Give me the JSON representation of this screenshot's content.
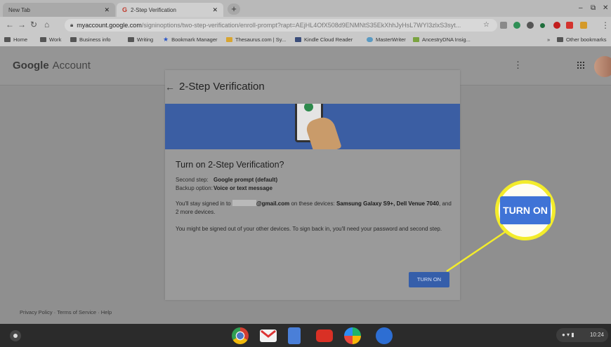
{
  "browser": {
    "tabs": [
      {
        "title": "New Tab",
        "close": "✕"
      },
      {
        "title": "2-Step Verification",
        "close": "✕",
        "favicon": "G"
      }
    ],
    "new_tab": "+",
    "window_controls": {
      "minimize": "–",
      "restore": "⧉",
      "close": "✕"
    },
    "url_host": "myaccount.google.com",
    "url_path": "/signinoptions/two-step-verification/enroll-prompt?rapt=AEjHL4OfX508d9ENMNtS35EkXhhJyHsL7WYI3zlxS3syt...",
    "bookmarks": [
      {
        "label": "Home",
        "icon": "folder-icon"
      },
      {
        "label": "Work",
        "icon": "folder-icon"
      },
      {
        "label": "Business info",
        "icon": "folder-icon"
      },
      {
        "label": "Writing",
        "icon": "folder-icon"
      },
      {
        "label": "Bookmark Manager",
        "icon": "star-icon"
      },
      {
        "label": "Thesaurus.com | Sy...",
        "icon": "thesaurus-icon"
      },
      {
        "label": "Kindle Cloud Reader",
        "icon": "kindle-icon"
      },
      {
        "label": "MasterWriter",
        "icon": "masterwriter-icon"
      },
      {
        "label": "AncestryDNA Insig...",
        "icon": "ancestry-icon"
      }
    ],
    "overflow": "»",
    "other_bookmarks": "Other bookmarks"
  },
  "account_header": {
    "logo": "Google",
    "account_word": "Account"
  },
  "card": {
    "title": "2-Step Verification",
    "prompt_title": "Turn on 2-Step Verification?",
    "second_step_label": "Second step:",
    "second_step_value": "Google prompt (default)",
    "backup_label": "Backup option:",
    "backup_value": "Voice or text message",
    "signed_in_pre": "You'll stay signed in to ",
    "signed_in_email": "@gmail.com",
    "signed_in_mid": " on these devices: ",
    "signed_in_devices": "Samsung Galaxy S9+, Dell Venue 7040",
    "signed_in_post": ", and 2 more devices.",
    "signout_text": "You might be signed out of your other devices. To sign back in, you'll need your password and second step.",
    "turn_on_label": "TURN ON"
  },
  "callout": {
    "label": "TURN ON",
    "color": "#f3ec2b"
  },
  "footer": {
    "privacy": "Privacy Policy",
    "sep1": " · ",
    "terms": "Terms of Service",
    "sep2": " · ",
    "help": "Help"
  },
  "shelf": {
    "apps": [
      "chrome-icon",
      "gmail-icon",
      "docs-icon",
      "youtube-icon",
      "play-store-icon",
      "messages-icon"
    ],
    "time": "10:24"
  }
}
